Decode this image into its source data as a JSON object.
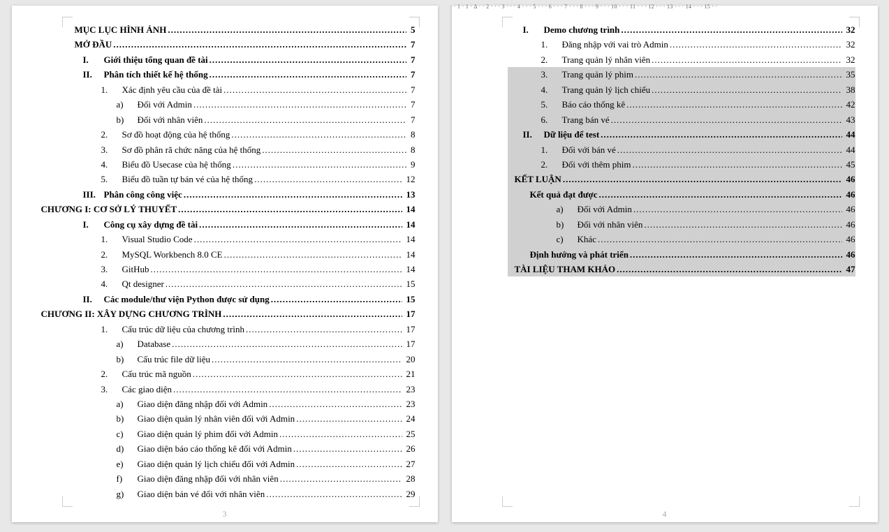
{
  "ruler_text": "· · 1 · 1 · Δ · · 2 · · · 3 · · · 4 · · · 5 · · · 6 · · · 7 · · · 8 · · · 9 · · · 10 · · · 11 · · · 12 · · · 13 · · · 14 · · · 15 · ·",
  "pages": [
    {
      "number": "3"
    },
    {
      "number": "4"
    }
  ],
  "toc_left": [
    {
      "marker": "",
      "label": "MỤC LỤC HÌNH ẢNH",
      "page": "5",
      "bold": true,
      "indent": 0
    },
    {
      "marker": "",
      "label": "MỞ ĐẦU",
      "page": "7",
      "bold": true,
      "indent": 0
    },
    {
      "marker": "I.",
      "label": "Giới thiệu tổng quan đề tài",
      "page": "7",
      "bold": true,
      "indent": 1
    },
    {
      "marker": "II.",
      "label": "Phân tích thiết kế hệ thống",
      "page": "7",
      "bold": true,
      "indent": 1
    },
    {
      "marker": "1.",
      "label": "Xác định yêu cầu của đề tài",
      "page": "7",
      "bold": false,
      "indent": 2
    },
    {
      "marker": "a)",
      "label": "Đối với Admin",
      "page": "7",
      "bold": false,
      "indent": 3
    },
    {
      "marker": "b)",
      "label": "Đối với nhân viên",
      "page": "7",
      "bold": false,
      "indent": 3
    },
    {
      "marker": "2.",
      "label": "Sơ đồ hoạt động của hệ thống",
      "page": "8",
      "bold": false,
      "indent": 2
    },
    {
      "marker": "3.",
      "label": "Sơ đồ phân rã chức năng của hệ thống",
      "page": "8",
      "bold": false,
      "indent": 2
    },
    {
      "marker": "4.",
      "label": "Biểu đồ Usecase của hệ thống",
      "page": "9",
      "bold": false,
      "indent": 2
    },
    {
      "marker": "5.",
      "label": "Biểu đồ tuần tự bán vé của hệ thống",
      "page": "12",
      "bold": false,
      "indent": 2
    },
    {
      "marker": "III.",
      "label": "Phân công công việc",
      "page": "13",
      "bold": true,
      "indent": 1
    },
    {
      "marker": "",
      "label": "CHƯƠNG I: CƠ SỞ LÝ THUYẾT",
      "page": "14",
      "bold": true,
      "indent": "0n"
    },
    {
      "marker": "I.",
      "label": "Công cụ xây dựng đề tài",
      "page": "14",
      "bold": true,
      "indent": 1
    },
    {
      "marker": "1.",
      "label": "Visual Studio Code",
      "page": "14",
      "bold": false,
      "indent": 2
    },
    {
      "marker": "2.",
      "label": "MySQL Workbench 8.0 CE",
      "page": "14",
      "bold": false,
      "indent": 2
    },
    {
      "marker": "3.",
      "label": "GitHub",
      "page": "14",
      "bold": false,
      "indent": 2
    },
    {
      "marker": "4.",
      "label": "Qt designer",
      "page": "15",
      "bold": false,
      "indent": 2
    },
    {
      "marker": "II.",
      "label": "Các module/thư viện Python được sử dụng",
      "page": "15",
      "bold": true,
      "indent": 1
    },
    {
      "marker": "",
      "label": "CHƯƠNG II: XÂY DỰNG CHƯƠNG TRÌNH",
      "page": "17",
      "bold": true,
      "indent": "0n"
    },
    {
      "marker": "1.",
      "label": "Cấu trúc dữ liệu của chương trình",
      "page": "17",
      "bold": false,
      "indent": 2
    },
    {
      "marker": "a)",
      "label": "Database",
      "page": "17",
      "bold": false,
      "indent": 3
    },
    {
      "marker": "b)",
      "label": "Cấu trúc file dữ liệu",
      "page": "20",
      "bold": false,
      "indent": 3
    },
    {
      "marker": "2.",
      "label": "Cấu trúc mã nguồn",
      "page": "21",
      "bold": false,
      "indent": 2
    },
    {
      "marker": "3.",
      "label": "Các giao diện",
      "page": "23",
      "bold": false,
      "indent": 2
    },
    {
      "marker": "a)",
      "label": "Giao diện đăng nhập đối với Admin",
      "page": "23",
      "bold": false,
      "indent": 3
    },
    {
      "marker": "b)",
      "label": "Giao diện quản lý nhân viên đối với Admin",
      "page": "24",
      "bold": false,
      "indent": 3
    },
    {
      "marker": "c)",
      "label": "Giao diện quản lý phim đối với Admin",
      "page": "25",
      "bold": false,
      "indent": 3
    },
    {
      "marker": "d)",
      "label": "Giao diện báo cáo thống kê đối với Admin",
      "page": "26",
      "bold": false,
      "indent": 3
    },
    {
      "marker": "e)",
      "label": "Giao diện quản lý lịch chiếu đối với Admin",
      "page": "27",
      "bold": false,
      "indent": 3
    },
    {
      "marker": "f)",
      "label": "Giao diện đăng nhập đối với nhân viên",
      "page": "28",
      "bold": false,
      "indent": 3
    },
    {
      "marker": "g)",
      "label": "Giao diện bán vé đối với nhân viên",
      "page": "29",
      "bold": false,
      "indent": 3
    }
  ],
  "toc_right": [
    {
      "marker": "I.",
      "label": "Demo chương trình",
      "page": "32",
      "bold": true,
      "indent": 1,
      "highlight": false
    },
    {
      "marker": "1.",
      "label": "Đăng nhập với vai trò Admin",
      "page": "32",
      "bold": false,
      "indent": 2,
      "highlight": false
    },
    {
      "marker": "2.",
      "label": "Trang quản lý nhân viên",
      "page": "32",
      "bold": false,
      "indent": 2,
      "highlight": false
    },
    {
      "marker": "3.",
      "label": "Trang quản lý phim",
      "page": "35",
      "bold": false,
      "indent": 2,
      "highlight": true
    },
    {
      "marker": "4.",
      "label": "Trang quản lý lịch chiếu",
      "page": "38",
      "bold": false,
      "indent": 2,
      "highlight": true
    },
    {
      "marker": "5.",
      "label": "Báo cáo thống kê",
      "page": "42",
      "bold": false,
      "indent": 2,
      "highlight": true
    },
    {
      "marker": "6.",
      "label": "Trang bán vé",
      "page": "43",
      "bold": false,
      "indent": 2,
      "highlight": true
    },
    {
      "marker": "II.",
      "label": "Dữ liệu để test",
      "page": "44",
      "bold": true,
      "indent": 1,
      "highlight": true
    },
    {
      "marker": "1.",
      "label": "Đối với bán vé",
      "page": "44",
      "bold": false,
      "indent": 2,
      "highlight": true
    },
    {
      "marker": "2.",
      "label": "Đối với thêm phim",
      "page": "45",
      "bold": false,
      "indent": 2,
      "highlight": true
    },
    {
      "marker": "",
      "label": "KẾT LUẬN",
      "page": "46",
      "bold": true,
      "indent": 0,
      "highlight": true
    },
    {
      "marker": "",
      "label": "Kết quả đạt được",
      "page": "46",
      "bold": true,
      "indent": 1,
      "highlight": true
    },
    {
      "marker": "a)",
      "label": "Đối với Admin",
      "page": "46",
      "bold": false,
      "indent": 3,
      "highlight": true
    },
    {
      "marker": "b)",
      "label": "Đối với nhân viên",
      "page": "46",
      "bold": false,
      "indent": 3,
      "highlight": true
    },
    {
      "marker": "c)",
      "label": "Khác",
      "page": "46",
      "bold": false,
      "indent": 3,
      "highlight": true
    },
    {
      "marker": "",
      "label": "Định hướng và phát triển",
      "page": "46",
      "bold": true,
      "indent": 1,
      "highlight": true
    },
    {
      "marker": "",
      "label": "TÀI LIỆU THAM KHẢO",
      "page": "47",
      "bold": true,
      "indent": 0,
      "highlight": true
    }
  ]
}
